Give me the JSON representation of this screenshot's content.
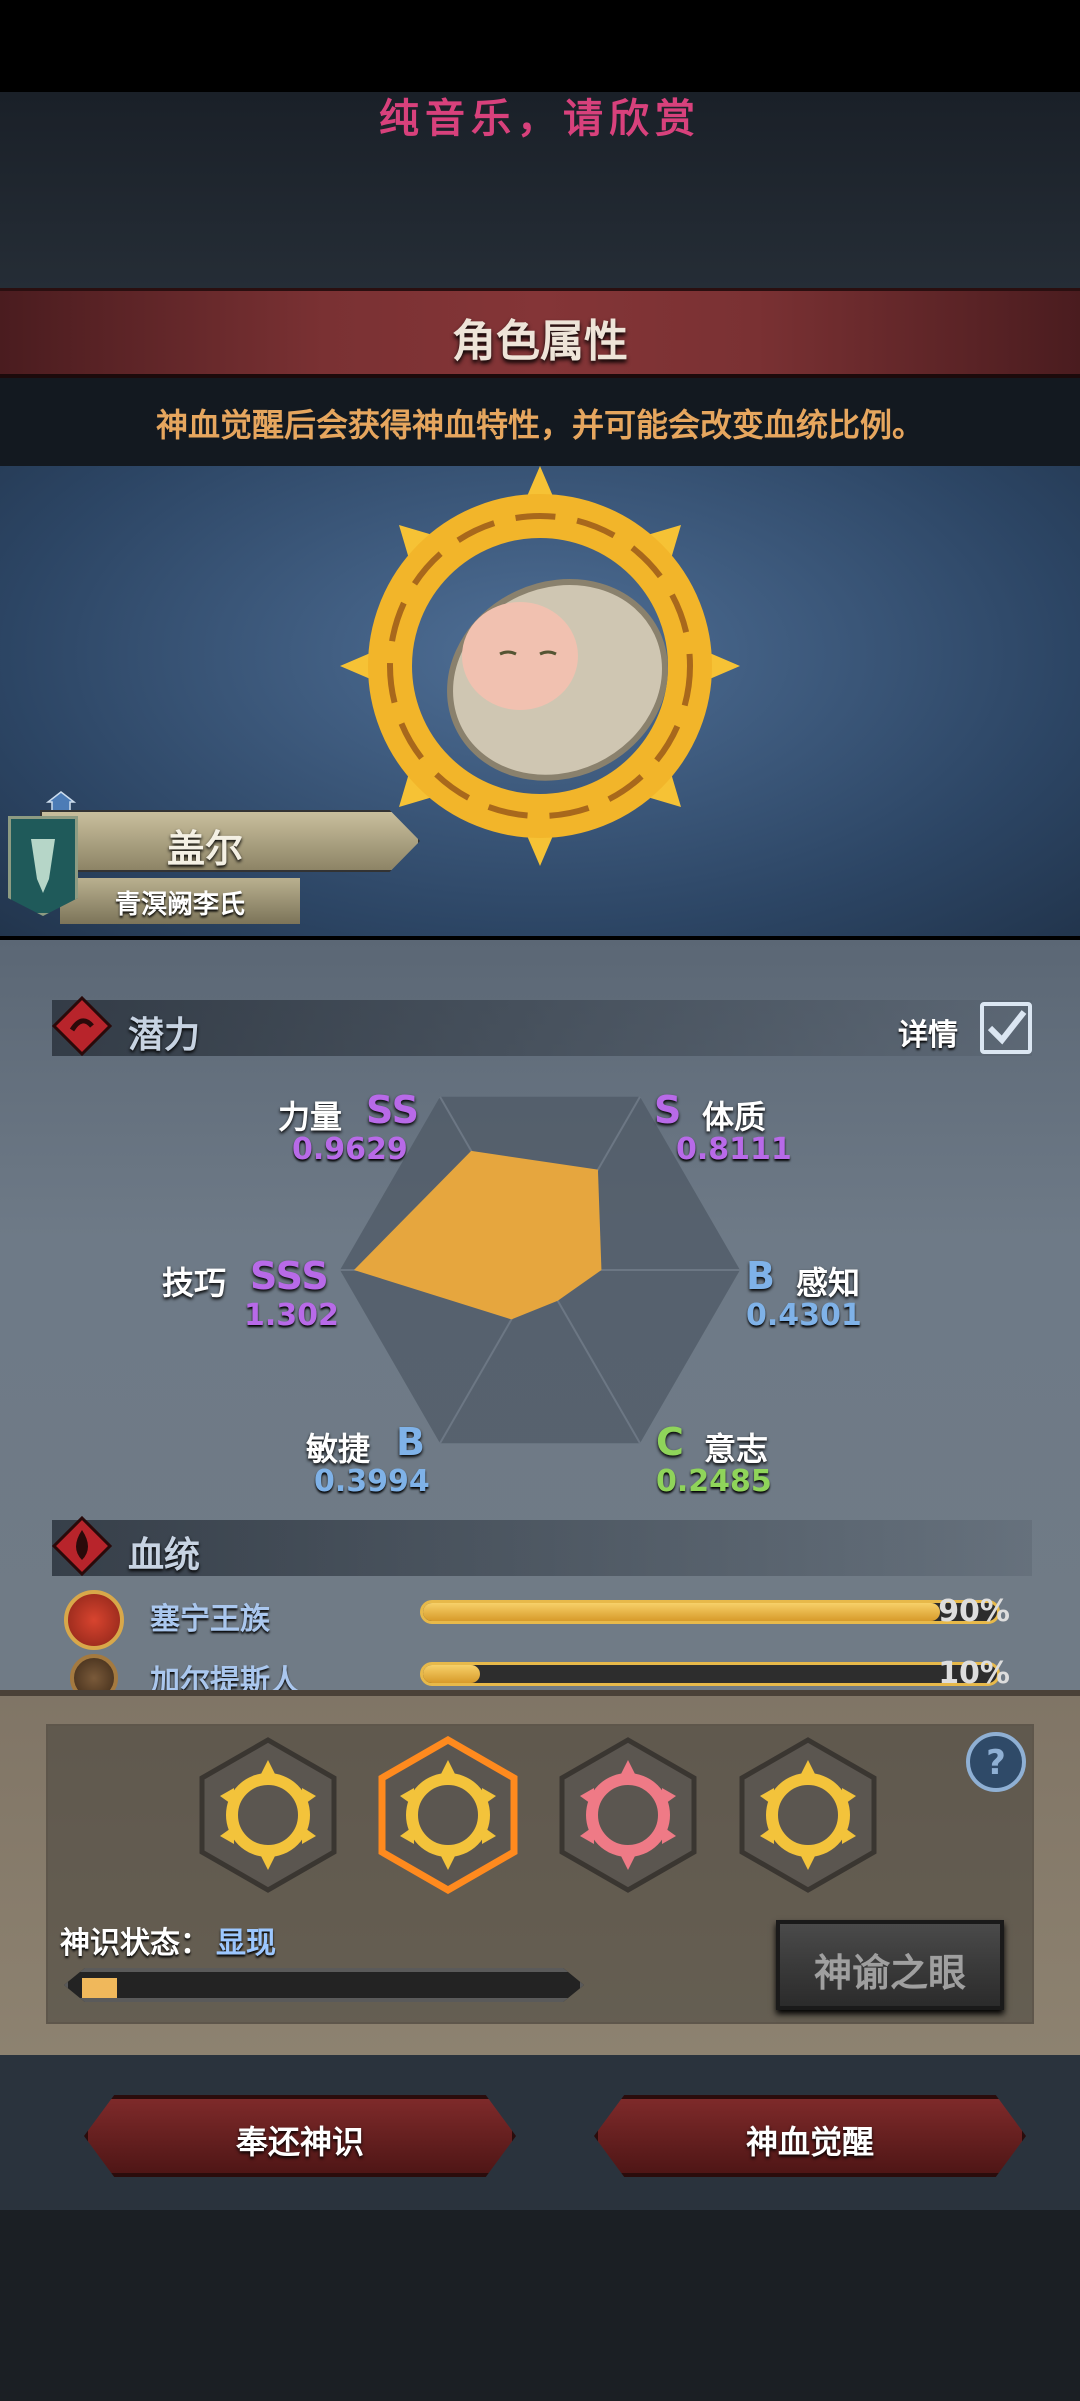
{
  "music_notice": "纯音乐，请欣赏",
  "title": "角色属性",
  "hint": "神血觉醒后会获得神血特性，并可能会改变血统比例。",
  "character": {
    "name": "盖尔",
    "clan": "青溟阙李氏"
  },
  "potential": {
    "section_title": "潜力",
    "detail_label": "详情",
    "detail_checked": true,
    "stats": [
      {
        "name": "力量",
        "grade": "SS",
        "value": "0.9629"
      },
      {
        "name": "体质",
        "grade": "S",
        "value": "0.8111"
      },
      {
        "name": "感知",
        "grade": "B",
        "value": "0.4301"
      },
      {
        "name": "意志",
        "grade": "C",
        "value": "0.2485"
      },
      {
        "name": "敏捷",
        "grade": "B",
        "value": "0.3994"
      },
      {
        "name": "技巧",
        "grade": "SSS",
        "value": "1.302"
      }
    ]
  },
  "bloodline": {
    "section_title": "血统",
    "items": [
      {
        "name": "塞宁王族",
        "percent": "90%",
        "fraction": 0.9
      },
      {
        "name": "加尔提斯人",
        "percent": "10%",
        "fraction": 0.1
      }
    ]
  },
  "divine": {
    "state_label": "神识状态：",
    "state_value": "显现",
    "progress_fraction": 0.07,
    "oracle_button": "神谕之眼"
  },
  "actions": {
    "return_label": "奉还神识",
    "awaken_label": "神血觉醒"
  },
  "colors": {
    "grade_ss": "#b86ae8",
    "grade_b": "#7fb2e8",
    "grade_c": "#8fd45a",
    "radar_fill": "#e6a63e",
    "accent_red": "#7e2a2a"
  }
}
